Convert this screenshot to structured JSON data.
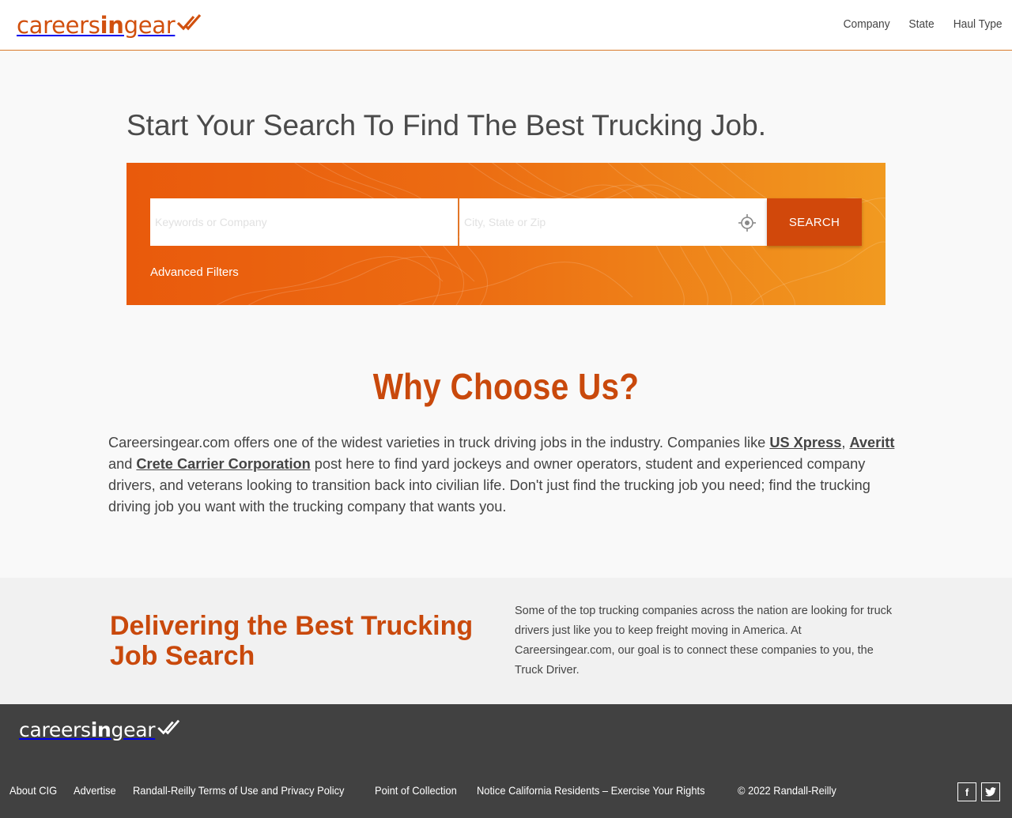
{
  "brand": {
    "logo_prefix": "careers",
    "logo_bold": "in",
    "logo_suffix": "gear",
    "primary_color": "#d1500e",
    "accent_gradient": [
      "#e95a0c",
      "#f19a20"
    ]
  },
  "nav": {
    "items": [
      {
        "label": "Company"
      },
      {
        "label": "State"
      },
      {
        "label": "Haul Type"
      }
    ]
  },
  "hero": {
    "title": "Start Your Search To Find The Best Trucking Job.",
    "keyword_placeholder": "Keywords or Company",
    "location_placeholder": "City, State or Zip",
    "location_icon": "crosshair-icon",
    "search_label": "SEARCH",
    "advanced_filters_label": "Advanced Filters"
  },
  "why": {
    "title": "Why Choose Us?",
    "text_1": "Careersingear.com offers one of the widest varieties in truck driving jobs in the industry. Companies like ",
    "link_1": "US Xpress",
    "sep_1": ", ",
    "link_2": "Averitt",
    "text_2": " and ",
    "link_3": "Crete Carrier Corporation",
    "text_3": " post here to find yard jockeys and owner operators, student and experienced company drivers, and veterans looking to transition back into civilian life. Don't just find the trucking job you need; find the trucking driving job you want with the trucking company that wants you."
  },
  "delivering": {
    "title": "Delivering the Best Trucking Job Search",
    "body": "Some of the top trucking companies across the nation are looking for truck drivers just like you to keep freight moving in America. At Careersingear.com, our goal is to connect these companies to you, the Truck Driver."
  },
  "footer": {
    "links": [
      {
        "label": "About CIG"
      },
      {
        "label": "Advertise"
      },
      {
        "label": "Randall-Reilly Terms of Use and Privacy Policy"
      },
      {
        "label": "Point of Collection"
      },
      {
        "label": "Notice California Residents – Exercise Your Rights"
      }
    ],
    "copyright": "© 2022 Randall-Reilly",
    "social": [
      {
        "icon": "facebook-icon",
        "glyph": "f"
      },
      {
        "icon": "twitter-icon",
        "glyph": "t"
      }
    ]
  }
}
